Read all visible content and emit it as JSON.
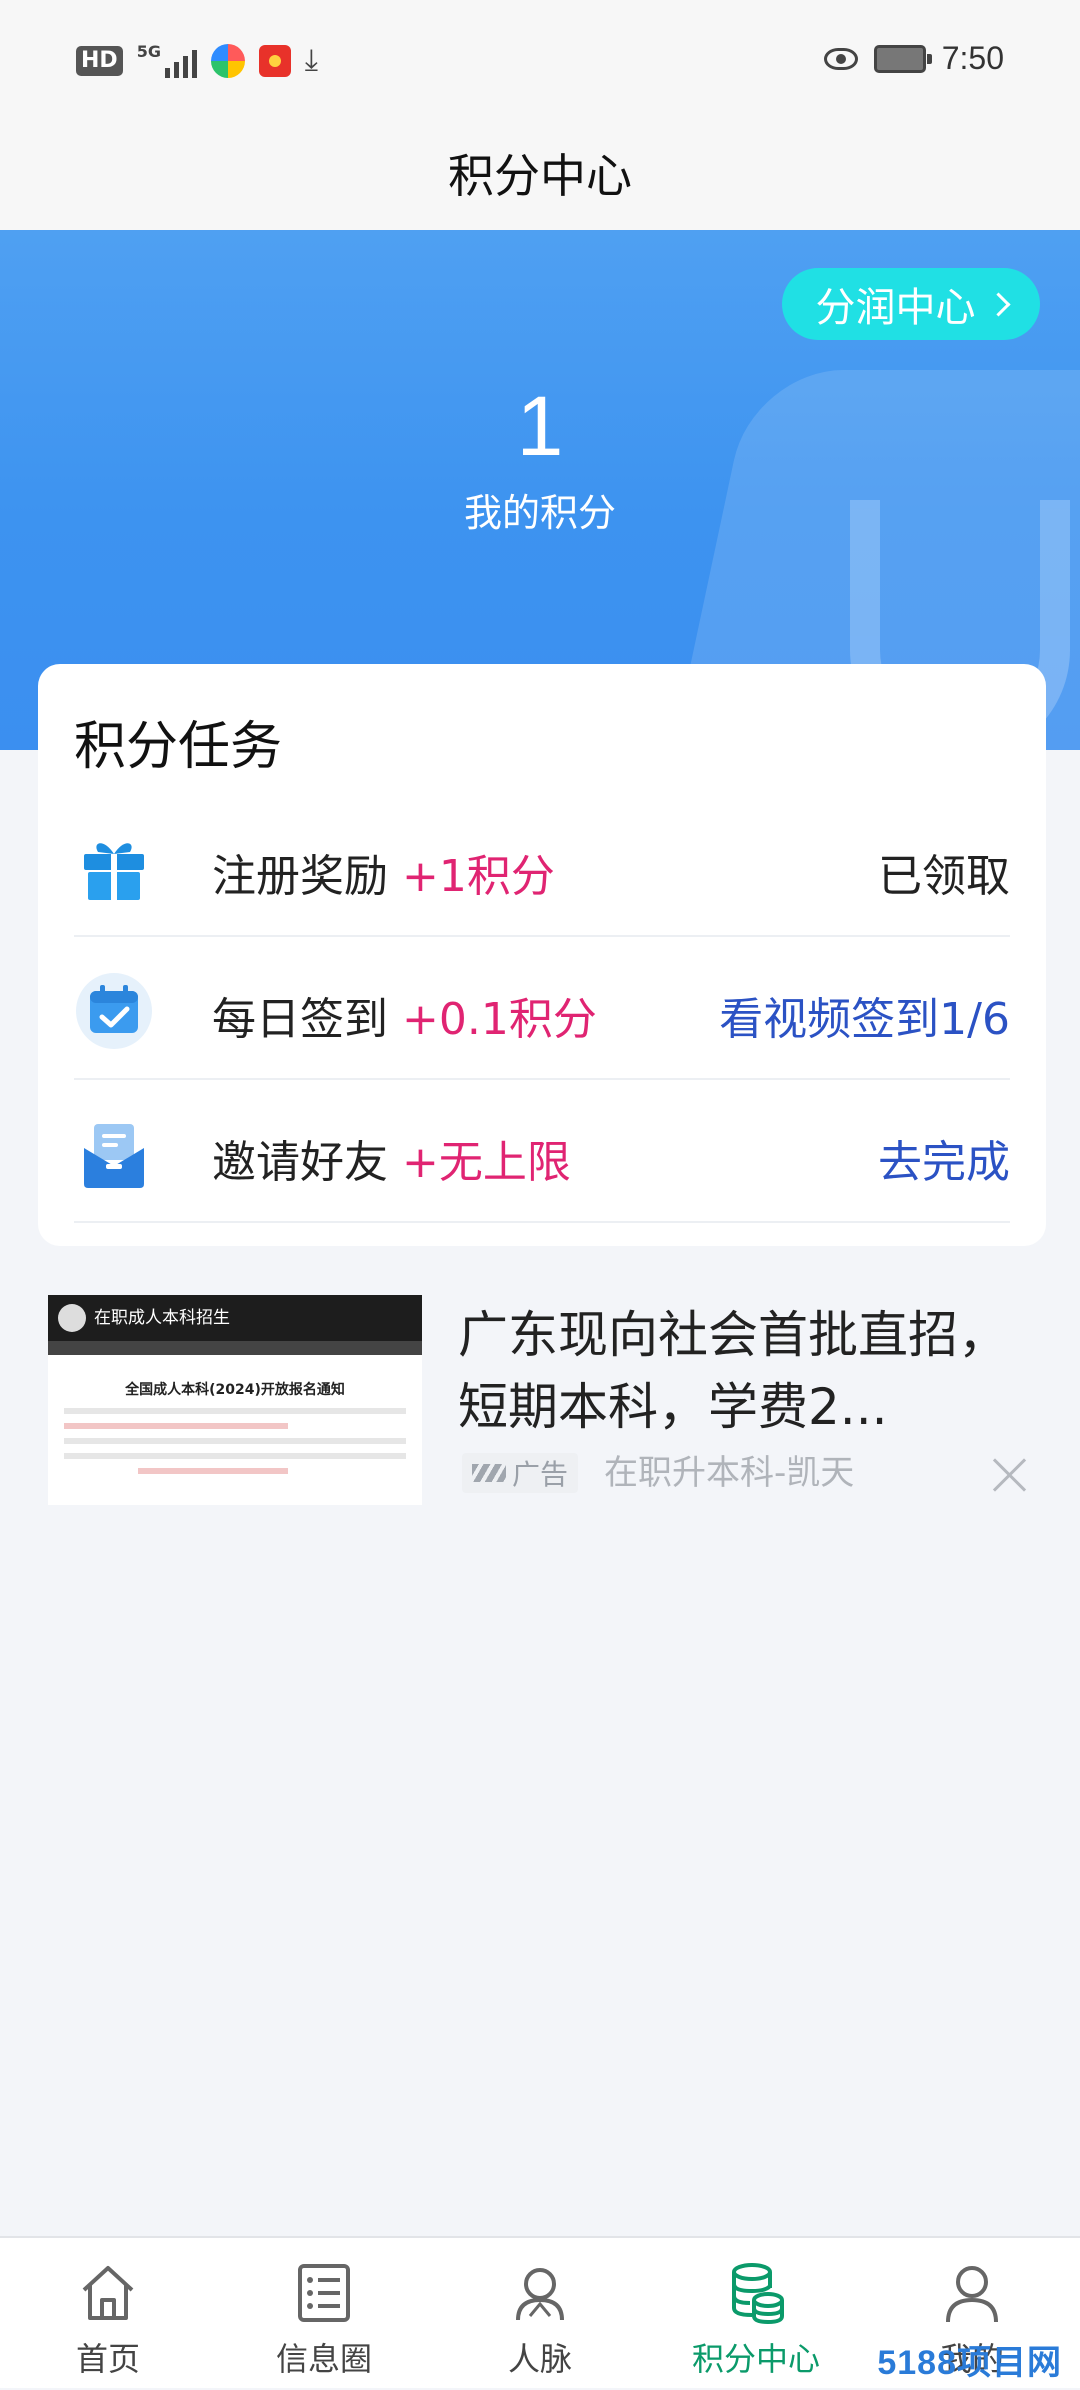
{
  "status_bar": {
    "hd": "HD",
    "network": "5G",
    "time": "7:50"
  },
  "header": {
    "title": "积分中心"
  },
  "hero": {
    "profit_center_label": "分润中心",
    "points_value": "1",
    "points_label": "我的积分"
  },
  "tasks": {
    "title": "积分任务",
    "items": [
      {
        "name": "注册奖励",
        "bonus": "+1积分",
        "action": "已领取",
        "icon": "gift-icon"
      },
      {
        "name": "每日签到",
        "bonus": "+0.1积分",
        "action": "看视频签到1/6",
        "icon": "calendar-check-icon"
      },
      {
        "name": "邀请好友",
        "bonus": "+无上限",
        "action": "去完成",
        "icon": "invite-envelope-icon"
      }
    ]
  },
  "ad": {
    "title": "广东现向社会首批直招，短期本科，学费2...",
    "badge": "广告",
    "source": "在职升本科-凯天",
    "image_header": "在职成人本科招生",
    "image_caption": "全国成人本科(2024)开放报名通知"
  },
  "bottom_nav": {
    "items": [
      {
        "label": "首页",
        "icon": "home-icon"
      },
      {
        "label": "信息圈",
        "icon": "list-document-icon"
      },
      {
        "label": "人脉",
        "icon": "people-icon"
      },
      {
        "label": "积分中心",
        "icon": "points-coins-icon",
        "active": true
      },
      {
        "label": "我的",
        "icon": "user-icon"
      }
    ]
  },
  "watermark": "5188项目网",
  "colors": {
    "accent_blue": "#3d93f0",
    "bonus_pink": "#e02472",
    "action_blue": "#2b52c4",
    "nav_active": "#0b9a6a",
    "profit_button": "#20e0e4"
  }
}
